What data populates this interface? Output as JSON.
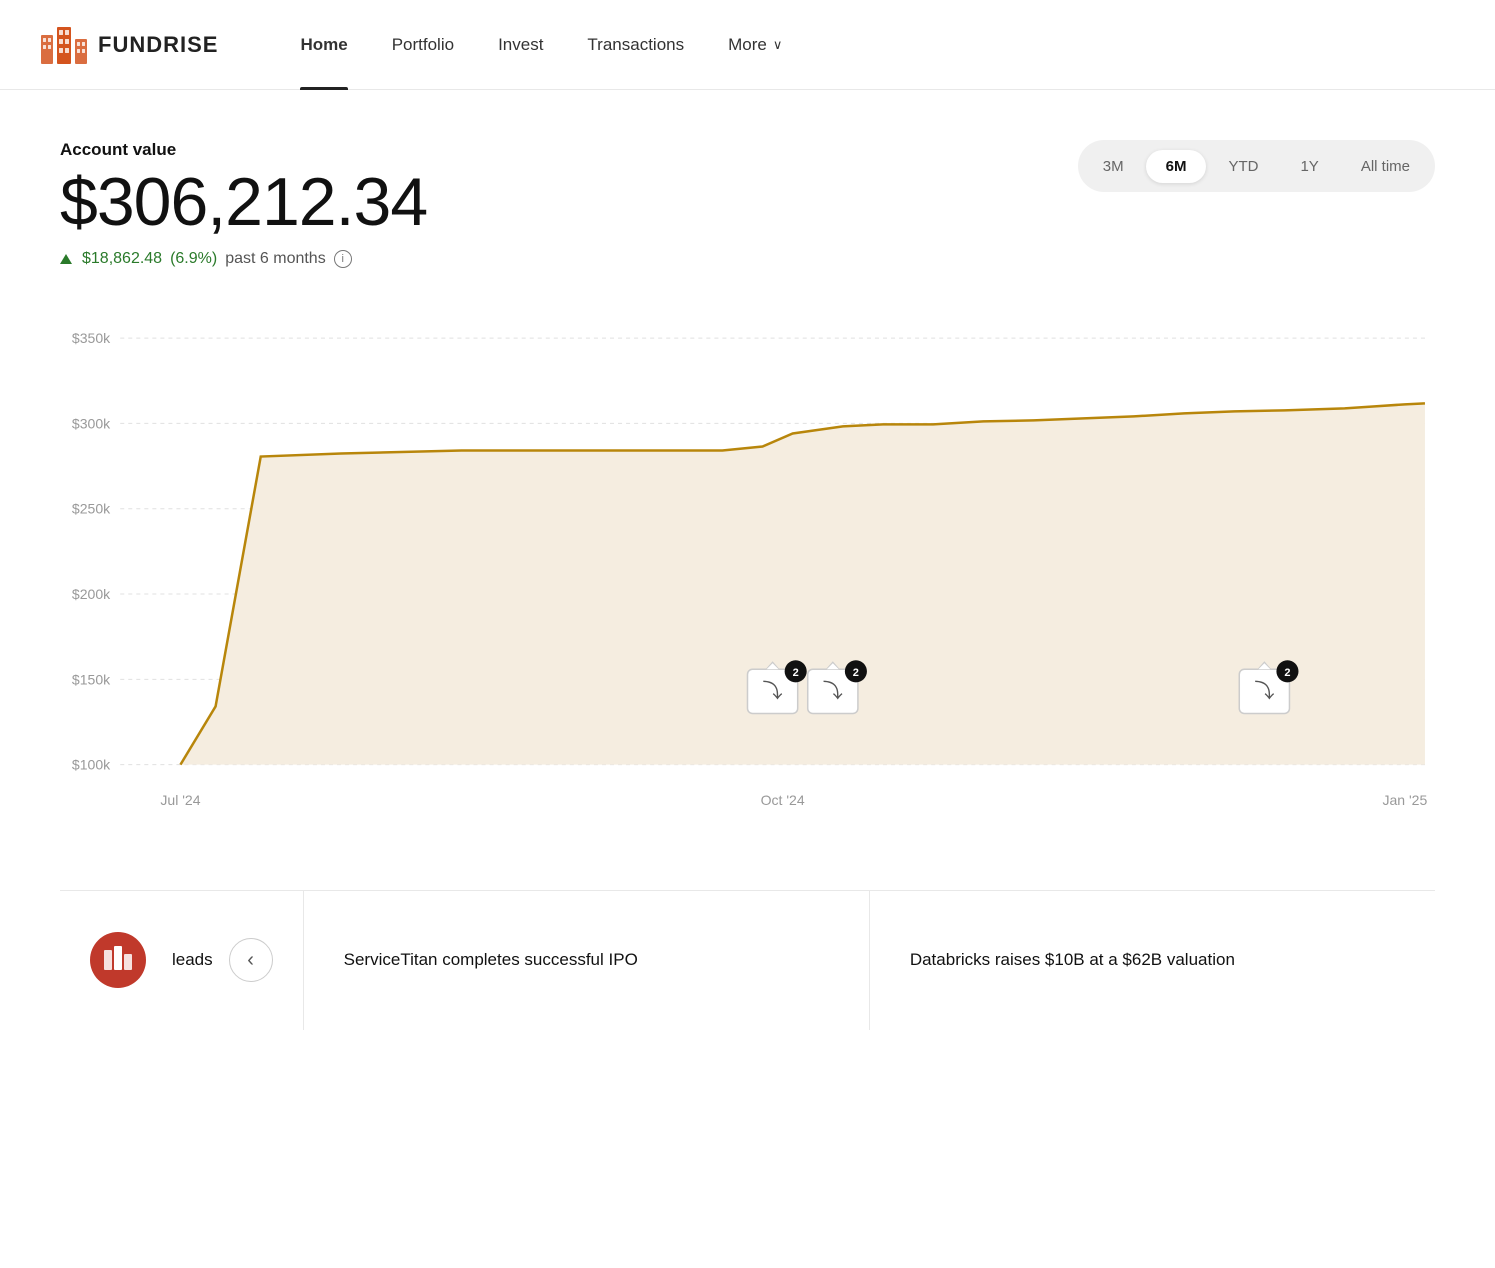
{
  "navbar": {
    "logo_text": "FUNDRISE",
    "links": [
      {
        "id": "home",
        "label": "Home",
        "active": true
      },
      {
        "id": "portfolio",
        "label": "Portfolio",
        "active": false
      },
      {
        "id": "invest",
        "label": "Invest",
        "active": false
      },
      {
        "id": "transactions",
        "label": "Transactions",
        "active": false
      },
      {
        "id": "more",
        "label": "More",
        "active": false,
        "has_chevron": true
      }
    ]
  },
  "account": {
    "label": "Account value",
    "value": "$306,212.34",
    "change_amount": "$18,862.48",
    "change_pct": "(6.9%)",
    "change_period": "past 6 months",
    "info_icon": "ⓘ"
  },
  "time_range": {
    "options": [
      {
        "id": "3m",
        "label": "3M",
        "active": false
      },
      {
        "id": "6m",
        "label": "6M",
        "active": true
      },
      {
        "id": "ytd",
        "label": "YTD",
        "active": false
      },
      {
        "id": "1y",
        "label": "1Y",
        "active": false
      },
      {
        "id": "alltime",
        "label": "All time",
        "active": false
      }
    ]
  },
  "chart": {
    "y_labels": [
      "$350k",
      "$300k",
      "$250k",
      "$200k",
      "$150k",
      "$100k"
    ],
    "x_labels": [
      "Jul '24",
      "Oct '24",
      "Jan '25"
    ],
    "line_color": "#b8860b",
    "fill_color": "#f5ede0",
    "markers": [
      {
        "id": "m1",
        "badge": "2",
        "x_pct": 52
      },
      {
        "id": "m2",
        "badge": "2",
        "x_pct": 57
      },
      {
        "id": "m3",
        "badge": "2",
        "x_pct": 88
      }
    ]
  },
  "news": {
    "items": [
      {
        "id": "n1",
        "text": "leads",
        "has_icon": true
      },
      {
        "id": "n2",
        "text": "ServiceTitan completes successful IPO",
        "has_icon": false
      },
      {
        "id": "n3",
        "text": "Databricks raises $10B at a $62B valuation",
        "has_icon": false
      }
    ],
    "prev_label": "‹",
    "next_label": "›"
  }
}
